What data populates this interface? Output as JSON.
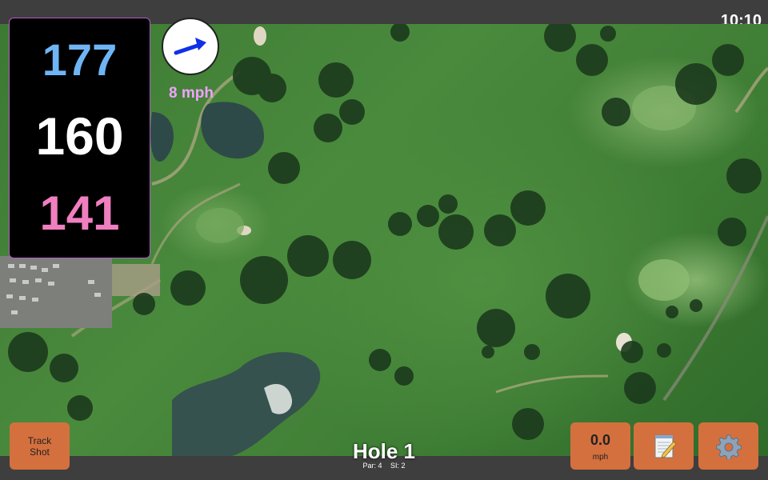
{
  "status": {
    "time": "10:10"
  },
  "distances": {
    "back": "177",
    "middle": "160",
    "front": "141"
  },
  "wind": {
    "speed": "8 mph",
    "icon": "wind-arrow-icon"
  },
  "hole": {
    "title": "Hole 1",
    "par": "Par: 4",
    "si": "SI: 2"
  },
  "buttons": {
    "track_shot": [
      "Track",
      "Shot"
    ],
    "speed_value": "0.0",
    "speed_unit": "mph",
    "notes_icon": "notepad-icon",
    "settings_icon": "gear-icon"
  },
  "colors": {
    "back_distance": "#6fb5f5",
    "middle_distance": "#ffffff",
    "front_distance": "#f07fc0",
    "wind_text": "#f0a2ff",
    "button": "#d4703e"
  }
}
